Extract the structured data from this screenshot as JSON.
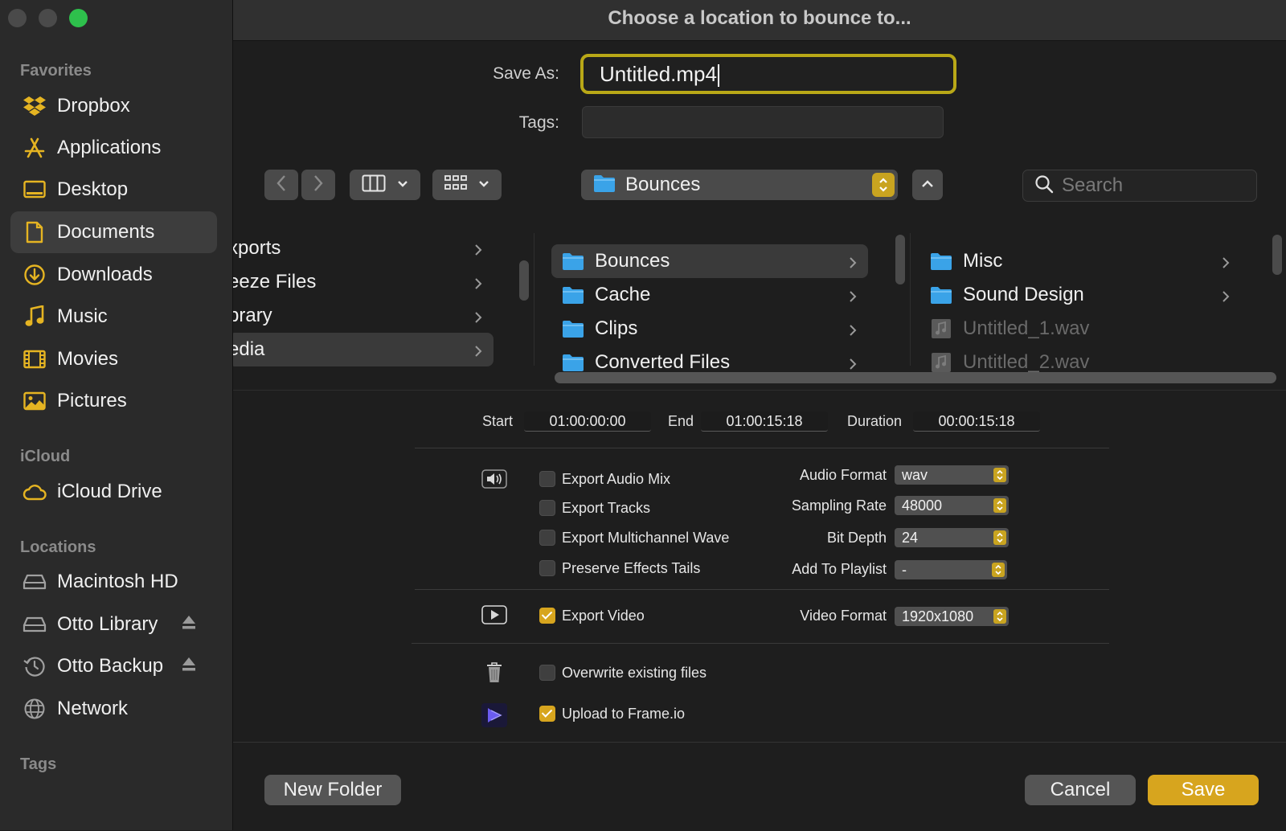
{
  "window": {
    "title": "Choose a location to bounce to..."
  },
  "sidebar": {
    "favorites_label": "Favorites",
    "favorites": [
      {
        "label": "Dropbox",
        "icon": "dropbox-icon"
      },
      {
        "label": "Applications",
        "icon": "applications-icon"
      },
      {
        "label": "Desktop",
        "icon": "desktop-icon"
      },
      {
        "label": "Documents",
        "icon": "document-icon",
        "selected": true
      },
      {
        "label": "Downloads",
        "icon": "download-icon"
      },
      {
        "label": "Music",
        "icon": "music-note-icon"
      },
      {
        "label": "Movies",
        "icon": "film-icon"
      },
      {
        "label": "Pictures",
        "icon": "picture-icon"
      }
    ],
    "icloud_label": "iCloud",
    "icloud": [
      {
        "label": "iCloud Drive",
        "icon": "cloud-icon"
      }
    ],
    "locations_label": "Locations",
    "locations": [
      {
        "label": "Macintosh HD",
        "icon": "hard-drive-icon"
      },
      {
        "label": "Otto Library",
        "icon": "hard-drive-icon",
        "eject": true
      },
      {
        "label": "Otto Backup",
        "icon": "time-machine-icon",
        "eject": true
      },
      {
        "label": "Network",
        "icon": "globe-icon"
      }
    ],
    "tags_label": "Tags"
  },
  "form": {
    "save_as_label": "Save As:",
    "save_as_value": "Untitled.mp4",
    "tags_label": "Tags:",
    "tags_value": ""
  },
  "toolbar": {
    "location": "Bounces",
    "search_placeholder": "Search"
  },
  "browser": {
    "col1": [
      {
        "label": "xports",
        "folder": true
      },
      {
        "label": "eeze Files",
        "folder": true
      },
      {
        "label": "brary",
        "folder": true
      },
      {
        "label": "edia",
        "folder": true,
        "selected": true
      }
    ],
    "col2": [
      {
        "label": "Bounces",
        "folder": true,
        "selected": true
      },
      {
        "label": "Cache",
        "folder": true
      },
      {
        "label": "Clips",
        "folder": true
      },
      {
        "label": "Converted Files",
        "folder": true
      }
    ],
    "col3": [
      {
        "label": "Misc",
        "folder": true
      },
      {
        "label": "Sound Design",
        "folder": true
      },
      {
        "label": "Untitled_1.wav",
        "folder": false
      },
      {
        "label": "Untitled_2.wav",
        "folder": false
      }
    ]
  },
  "timecode": {
    "start_label": "Start",
    "start": "01:00:00:00",
    "end_label": "End",
    "end": "01:00:15:18",
    "duration_label": "Duration",
    "duration": "00:00:15:18"
  },
  "audio": {
    "checkboxes": [
      {
        "label": "Export Audio Mix",
        "checked": false
      },
      {
        "label": "Export Tracks",
        "checked": false
      },
      {
        "label": "Export Multichannel Wave",
        "checked": false
      },
      {
        "label": "Preserve Effects Tails",
        "checked": false
      }
    ],
    "selects": [
      {
        "label": "Audio Format",
        "value": "wav"
      },
      {
        "label": "Sampling Rate",
        "value": "48000"
      },
      {
        "label": "Bit Depth",
        "value": "24"
      },
      {
        "label": "Add To Playlist",
        "value": "-"
      }
    ]
  },
  "video": {
    "export_label": "Export Video",
    "export_checked": true,
    "format_label": "Video Format",
    "format_value": "1920x1080"
  },
  "misc": {
    "overwrite_label": "Overwrite existing files",
    "overwrite_checked": false,
    "frameio_label": "Upload to Frame.io",
    "frameio_checked": true
  },
  "footer": {
    "new_folder": "New Folder",
    "cancel": "Cancel",
    "save": "Save"
  },
  "colors": {
    "accent": "#d7a51e",
    "focus_ring": "#b9a817",
    "folder": "#3aa3e8",
    "zoom": "#2ec04c"
  }
}
